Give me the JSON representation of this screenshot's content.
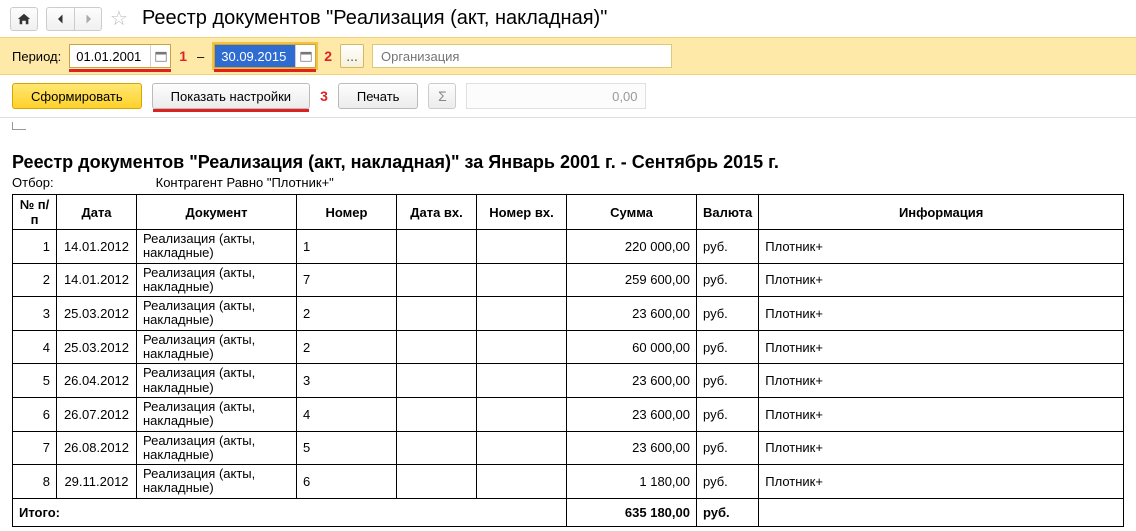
{
  "header": {
    "title": "Реестр документов \"Реализация (акт, накладная)\""
  },
  "period": {
    "label": "Период:",
    "from": "01.01.2001",
    "to": "30.09.2015",
    "callout1": "1",
    "callout2": "2",
    "org_placeholder": "Организация",
    "sep": "–",
    "ellipsis": "..."
  },
  "actions": {
    "form": "Сформировать",
    "show_settings": "Показать настройки",
    "print": "Печать",
    "sigma": "Σ",
    "sum_display": "0,00",
    "callout3": "3"
  },
  "report": {
    "title": "Реестр документов \"Реализация (акт, накладная)\"  за Январь 2001 г. - Сентябрь 2015 г.",
    "filter_label": "Отбор:",
    "filter_value": "Контрагент Равно \"Плотник+\"",
    "columns": {
      "num": "№ п/п",
      "date": "Дата",
      "doc": "Документ",
      "nomer": "Номер",
      "date_in": "Дата вх.",
      "nomer_in": "Номер вх.",
      "sum": "Сумма",
      "currency": "Валюта",
      "info": "Информация"
    },
    "rows": [
      {
        "num": "1",
        "date": "14.01.2012",
        "doc": "Реализация (акты, накладные)",
        "nomer": "1",
        "date_in": "",
        "nomer_in": "",
        "sum": "220 000,00",
        "currency": "руб.",
        "info": "Плотник+"
      },
      {
        "num": "2",
        "date": "14.01.2012",
        "doc": "Реализация (акты, накладные)",
        "nomer": "7",
        "date_in": "",
        "nomer_in": "",
        "sum": "259 600,00",
        "currency": "руб.",
        "info": "Плотник+"
      },
      {
        "num": "3",
        "date": "25.03.2012",
        "doc": "Реализация (акты, накладные)",
        "nomer": "2",
        "date_in": "",
        "nomer_in": "",
        "sum": "23 600,00",
        "currency": "руб.",
        "info": "Плотник+"
      },
      {
        "num": "4",
        "date": "25.03.2012",
        "doc": "Реализация (акты, накладные)",
        "nomer": "2",
        "date_in": "",
        "nomer_in": "",
        "sum": "60 000,00",
        "currency": "руб.",
        "info": "Плотник+"
      },
      {
        "num": "5",
        "date": "26.04.2012",
        "doc": "Реализация (акты, накладные)",
        "nomer": "3",
        "date_in": "",
        "nomer_in": "",
        "sum": "23 600,00",
        "currency": "руб.",
        "info": "Плотник+"
      },
      {
        "num": "6",
        "date": "26.07.2012",
        "doc": "Реализация (акты, накладные)",
        "nomer": "4",
        "date_in": "",
        "nomer_in": "",
        "sum": "23 600,00",
        "currency": "руб.",
        "info": "Плотник+"
      },
      {
        "num": "7",
        "date": "26.08.2012",
        "doc": "Реализация (акты, накладные)",
        "nomer": "5",
        "date_in": "",
        "nomer_in": "",
        "sum": "23 600,00",
        "currency": "руб.",
        "info": "Плотник+"
      },
      {
        "num": "8",
        "date": "29.11.2012",
        "doc": "Реализация (акты, накладные)",
        "nomer": "6",
        "date_in": "",
        "nomer_in": "",
        "sum": "1 180,00",
        "currency": "руб.",
        "info": "Плотник+"
      }
    ],
    "total": {
      "label": "Итого:",
      "sum": "635 180,00",
      "currency": "руб."
    }
  }
}
